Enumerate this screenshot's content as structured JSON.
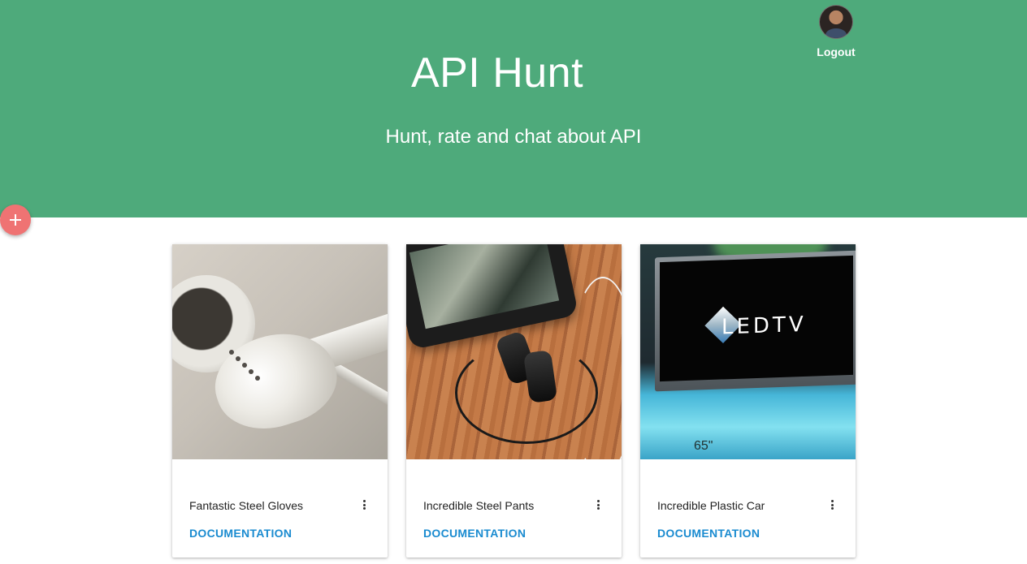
{
  "header": {
    "title": "API Hunt",
    "subtitle": "Hunt, rate and chat about API",
    "background_color": "#4eaa7b"
  },
  "user": {
    "avatar_icon": "user-avatar",
    "logout_label": "Logout"
  },
  "fab": {
    "icon": "plus-icon",
    "color": "#ef7373"
  },
  "cards": [
    {
      "title": "Fantastic Steel Gloves",
      "link_label": "DOCUMENTATION",
      "image": "earbuds-photo"
    },
    {
      "title": "Incredible Steel Pants",
      "link_label": "DOCUMENTATION",
      "image": "phone-headphones-photo"
    },
    {
      "title": "Incredible Plastic Car",
      "link_label": "DOCUMENTATION",
      "image": "led-tv-photo",
      "image_text": "LEDTV",
      "image_caption": "65\""
    }
  ],
  "link_color": "#1a8bd0"
}
